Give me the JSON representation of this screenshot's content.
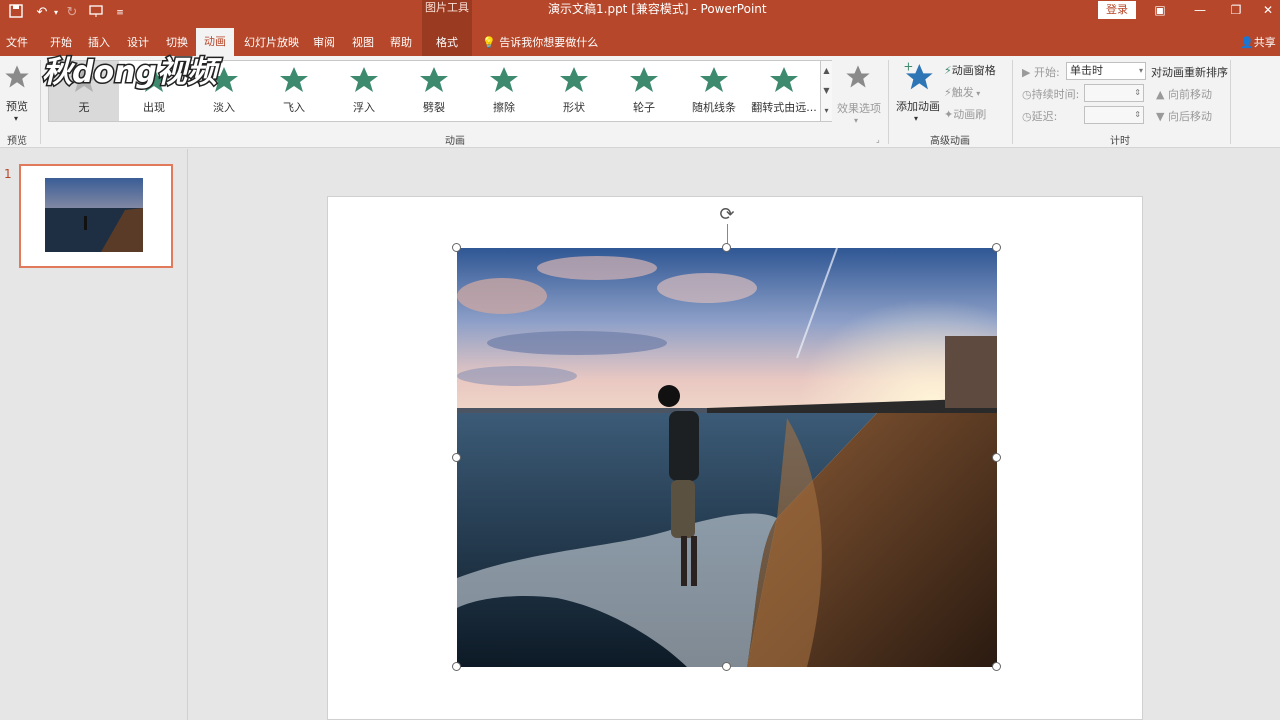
{
  "window": {
    "title": "演示文稿1.ppt [兼容模式] - PowerPoint",
    "context_group": "图片工具",
    "login": "登录"
  },
  "tabs": {
    "file": "文件",
    "home": "开始",
    "insert": "插入",
    "design": "设计",
    "transitions": "切换",
    "animations": "动画",
    "slideshow": "幻灯片放映",
    "review": "审阅",
    "view": "视图",
    "help": "帮助",
    "format": "格式",
    "tell_me": "告诉我你想要做什么",
    "share": "共享"
  },
  "ribbon": {
    "preview": {
      "button": "预览",
      "group": "预览"
    },
    "animation_group": {
      "label": "动画",
      "items": [
        {
          "label": "无",
          "selected": true
        },
        {
          "label": "出现"
        },
        {
          "label": "淡入"
        },
        {
          "label": "飞入"
        },
        {
          "label": "浮入"
        },
        {
          "label": "劈裂"
        },
        {
          "label": "擦除"
        },
        {
          "label": "形状"
        },
        {
          "label": "轮子"
        },
        {
          "label": "随机线条"
        },
        {
          "label": "翻转式由远..."
        }
      ],
      "effect_options": "效果选项"
    },
    "advanced": {
      "label": "高级动画",
      "add_animation": "添加动画",
      "animation_pane": "动画窗格",
      "trigger": "触发",
      "painter": "动画刷"
    },
    "timing": {
      "label": "计时",
      "start_label": "开始:",
      "start_value": "单击时",
      "duration_label": "持续时间:",
      "duration_value": "",
      "delay_label": "延迟:",
      "delay_value": "",
      "reorder_title": "对动画重新排序",
      "move_earlier": "向前移动",
      "move_later": "向后移动"
    }
  },
  "slides_panel": {
    "slide_number": "1"
  },
  "watermark": {
    "text": "秋dong视频"
  },
  "colors": {
    "accent": "#b7472a",
    "star_green": "#3e8a6e",
    "star_gray": "#8a8a8a"
  }
}
